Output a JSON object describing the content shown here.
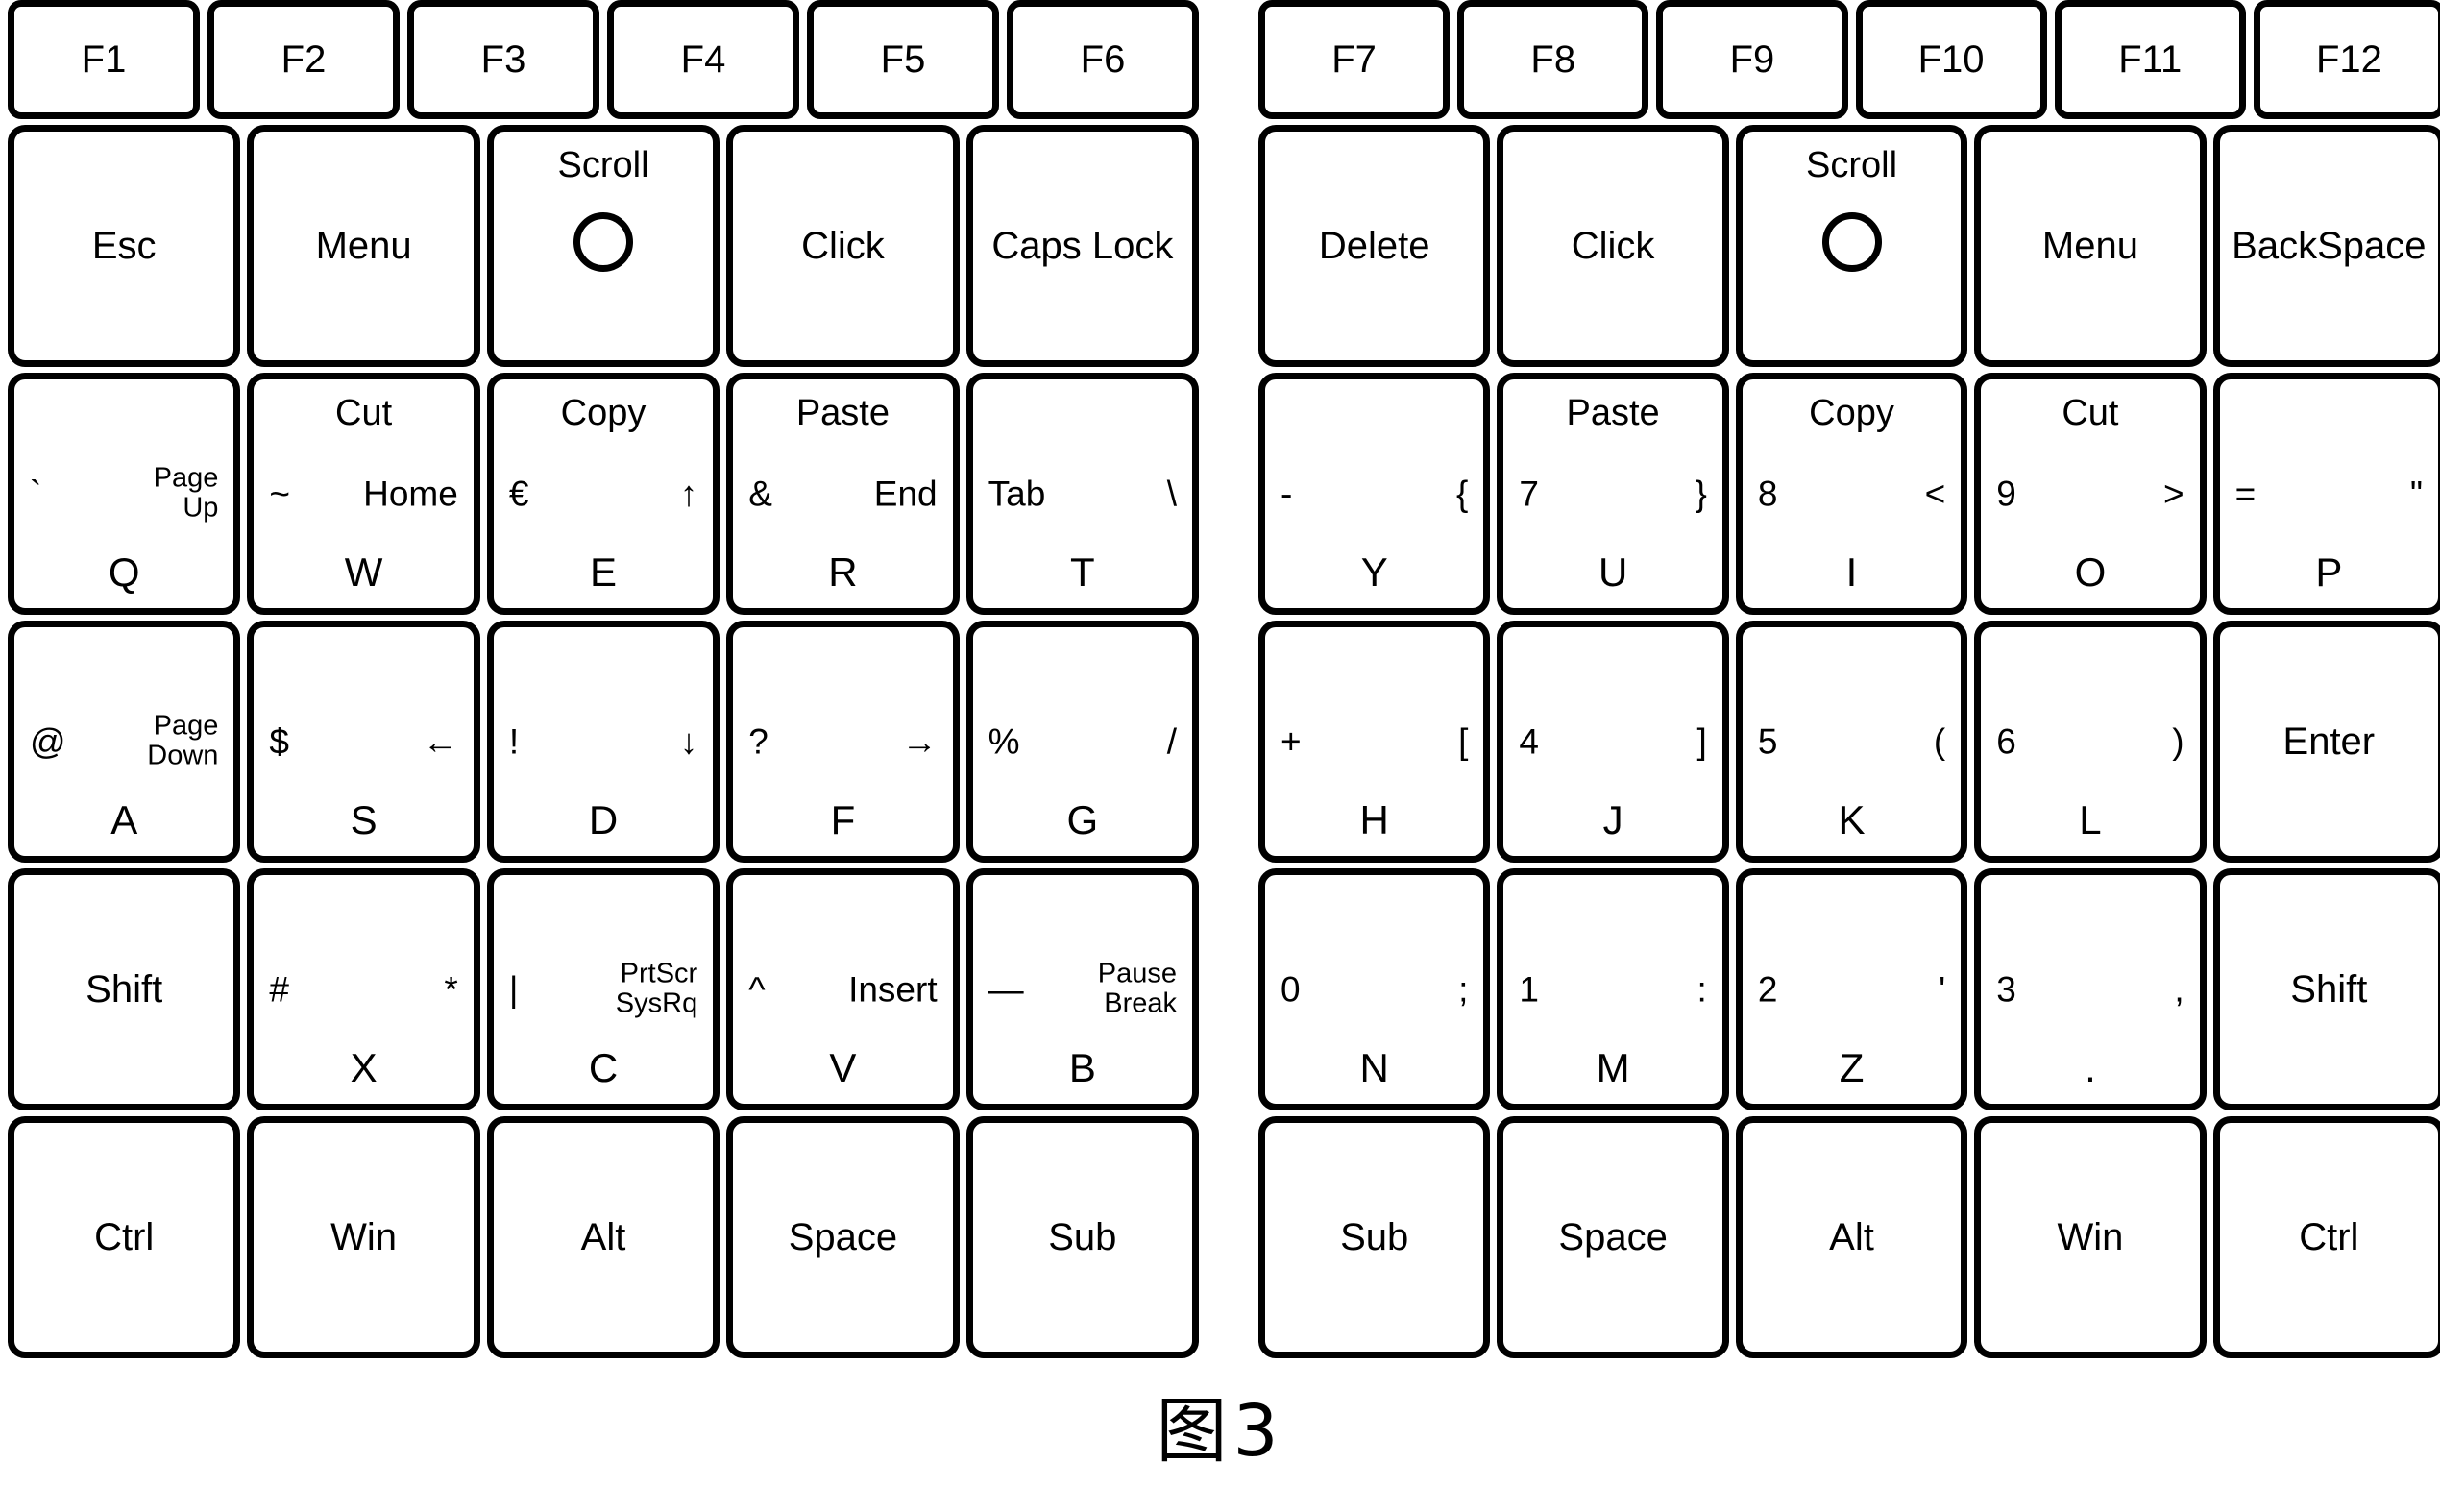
{
  "figure": {
    "caption": "图3"
  },
  "icons": {
    "scroll_wheel": "circle-icon"
  },
  "keyboard": {
    "left_half": {
      "function_row": [
        {
          "center": "F1"
        },
        {
          "center": "F2"
        },
        {
          "center": "F3"
        },
        {
          "center": "F4"
        },
        {
          "center": "F5"
        },
        {
          "center": "F6"
        }
      ],
      "rows": [
        {
          "name": "row-modifier",
          "keys": [
            {
              "center": "Esc"
            },
            {
              "center": "Menu"
            },
            {
              "top": "Scroll",
              "wheel": true
            },
            {
              "center": "Click"
            },
            {
              "center": "Caps Lock"
            }
          ]
        },
        {
          "name": "row-qwert",
          "keys": [
            {
              "left": "`",
              "right": "Page\nUp",
              "bottom": "Q"
            },
            {
              "top": "Cut",
              "left": "~",
              "right": "Home",
              "bottom": "W"
            },
            {
              "top": "Copy",
              "left": "€",
              "right": "↑",
              "bottom": "E"
            },
            {
              "top": "Paste",
              "left": "&",
              "right": "End",
              "bottom": "R"
            },
            {
              "left": "Tab",
              "right": "\\",
              "bottom": "T"
            }
          ]
        },
        {
          "name": "row-asdfg",
          "keys": [
            {
              "left": "@",
              "right": "Page\nDown",
              "bottom": "A"
            },
            {
              "left": "$",
              "right": "←",
              "bottom": "S"
            },
            {
              "left": "!",
              "right": "↓",
              "bottom": "D"
            },
            {
              "left": "?",
              "right": "→",
              "bottom": "F"
            },
            {
              "left": "%",
              "right": "/",
              "bottom": "G"
            }
          ]
        },
        {
          "name": "row-zxcvb",
          "keys": [
            {
              "center": "Shift"
            },
            {
              "left": "#",
              "right": "*",
              "bottom": "X"
            },
            {
              "left": "|",
              "right": "PrtScr\nSysRq",
              "bottom": "C"
            },
            {
              "left": "^",
              "right": "Insert",
              "bottom": "V"
            },
            {
              "left": "—",
              "right": "Pause\nBreak",
              "bottom": "B"
            }
          ]
        },
        {
          "name": "row-bottom",
          "keys": [
            {
              "center": "Ctrl"
            },
            {
              "center": "Win"
            },
            {
              "center": "Alt"
            },
            {
              "center": "Space"
            },
            {
              "center": "Sub"
            }
          ]
        }
      ]
    },
    "right_half": {
      "function_row": [
        {
          "center": "F7"
        },
        {
          "center": "F8"
        },
        {
          "center": "F9"
        },
        {
          "center": "F10"
        },
        {
          "center": "F11"
        },
        {
          "center": "F12"
        }
      ],
      "rows": [
        {
          "name": "row-modifier",
          "keys": [
            {
              "center": "Delete"
            },
            {
              "center": "Click"
            },
            {
              "top": "Scroll",
              "wheel": true
            },
            {
              "center": "Menu"
            },
            {
              "center": "BackSpace"
            }
          ]
        },
        {
          "name": "row-yuiop",
          "keys": [
            {
              "left": "-",
              "right": "{",
              "bottom": "Y"
            },
            {
              "top": "Paste",
              "left": "7",
              "right": "}",
              "bottom": "U"
            },
            {
              "top": "Copy",
              "left": "8",
              "right": "<",
              "bottom": "I"
            },
            {
              "top": "Cut",
              "left": "9",
              "right": ">",
              "bottom": "O"
            },
            {
              "left": "=",
              "right": "\"",
              "bottom": "P"
            }
          ]
        },
        {
          "name": "row-hjkl",
          "keys": [
            {
              "left": "+",
              "right": "[",
              "bottom": "H"
            },
            {
              "left": "4",
              "right": "]",
              "bottom": "J"
            },
            {
              "left": "5",
              "right": "(",
              "bottom": "K"
            },
            {
              "left": "6",
              "right": ")",
              "bottom": "L"
            },
            {
              "center": "Enter"
            }
          ]
        },
        {
          "name": "row-nmz",
          "keys": [
            {
              "left": "0",
              "right": ";",
              "bottom": "N"
            },
            {
              "left": "1",
              "right": ":",
              "bottom": "M"
            },
            {
              "left": "2",
              "right": "'",
              "bottom": "Z"
            },
            {
              "left": "3",
              "right": ",",
              "bottom": "."
            },
            {
              "center": "Shift"
            }
          ]
        },
        {
          "name": "row-bottom",
          "keys": [
            {
              "center": "Sub"
            },
            {
              "center": "Space"
            },
            {
              "center": "Alt"
            },
            {
              "center": "Win"
            },
            {
              "center": "Ctrl"
            }
          ]
        }
      ]
    }
  }
}
